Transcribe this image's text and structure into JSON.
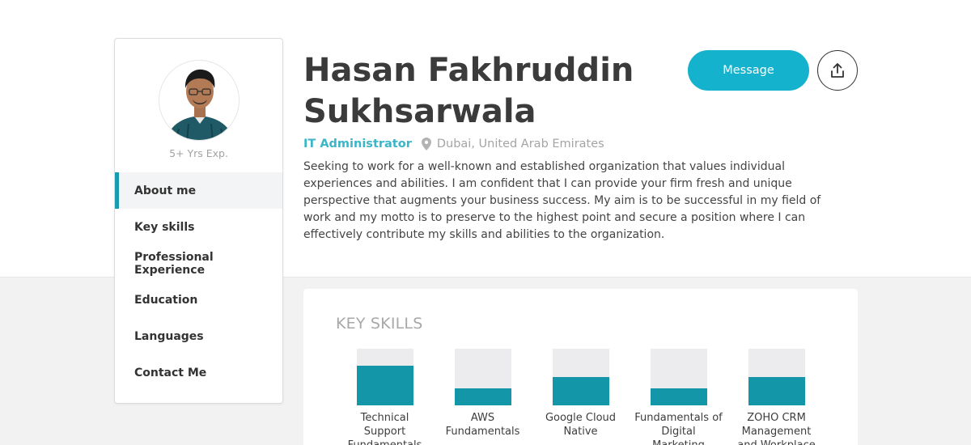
{
  "profile": {
    "name": "Hasan Fakhruddin Sukhsarwala",
    "experience": "5+ Yrs Exp.",
    "role": "IT Administrator",
    "location": "Dubai, United Arab Emirates",
    "about": "Seeking to work for a well-known and established organization that values individual experiences and abilities. I am confident that I can provide your firm fresh and unique perspective that augments your business success. My aim is to be successful in my field of work and my motto is to preserve to the highest point and secure a position where I can effectively contribute my skills and abilities to the organization."
  },
  "sidebar": {
    "items": [
      {
        "label": "About me",
        "active": true
      },
      {
        "label": "Key skills"
      },
      {
        "label": "Professional Experience"
      },
      {
        "label": "Education"
      },
      {
        "label": "Languages"
      },
      {
        "label": "Contact Me"
      }
    ]
  },
  "actions": {
    "message_label": "Message",
    "share_icon": "share-upload-icon"
  },
  "skills": {
    "title": "KEY SKILLS",
    "items": [
      {
        "label": "Technical Support Fundamentals",
        "level": 0.7
      },
      {
        "label": "AWS Fundamentals",
        "level": 0.3
      },
      {
        "label": "Google Cloud Native",
        "level": 0.5
      },
      {
        "label": "Fundamentals of Digital Marketing",
        "level": 0.3
      },
      {
        "label": "ZOHO CRM Management and Workplace",
        "level": 0.5
      }
    ]
  },
  "colors": {
    "accent": "#14b2cc",
    "bar_fill": "#1396a8",
    "bar_track": "#ececee"
  }
}
